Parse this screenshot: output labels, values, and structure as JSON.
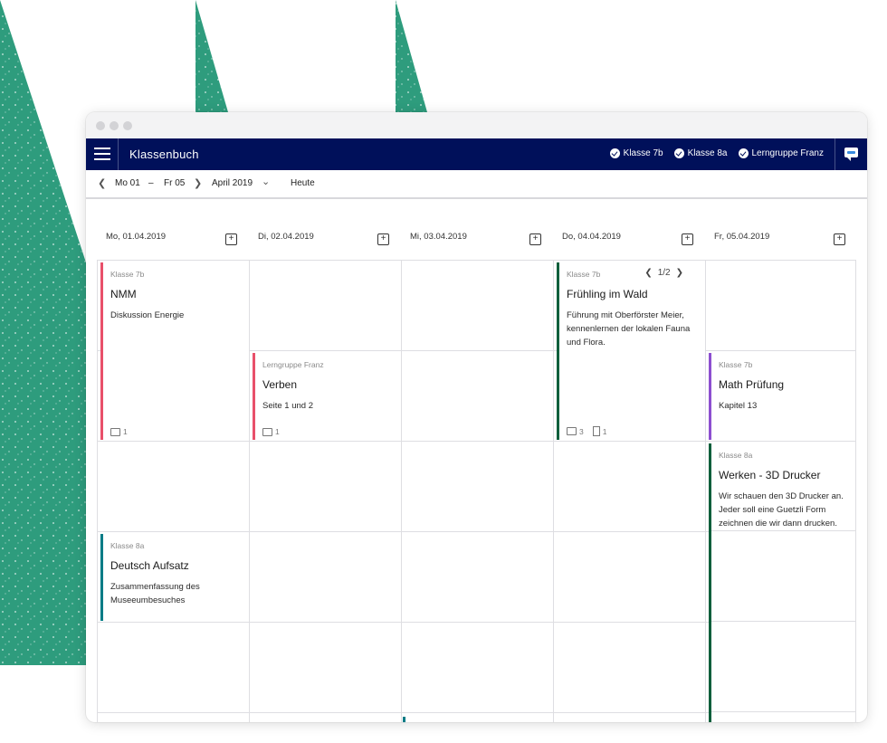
{
  "colors": {
    "brand_navy": "#00105a",
    "deco_green": "#2e9c7d",
    "event_red": "#e8506a",
    "event_green": "#0b5f3c",
    "event_purple": "#8d4fd0",
    "event_teal": "#007c86"
  },
  "app": {
    "title": "Klassenbuch",
    "menu_icon": "hamburger-icon",
    "chat_icon": "chat-bubble-icon",
    "classes": [
      "Klasse 7b",
      "Klasse 8a",
      "Lerngruppe Franz"
    ]
  },
  "nav": {
    "range_start": "Mo 01",
    "range_sep": "–",
    "range_end": "Fr 05",
    "month": "April 2019",
    "today": "Heute",
    "prev_icon": "chevron-left-icon",
    "next_icon": "chevron-right-icon",
    "month_icon": "chevron-down-icon"
  },
  "days": [
    {
      "label": "Mo, 01.04.2019"
    },
    {
      "label": "Di, 02.04.2019"
    },
    {
      "label": "Mi, 03.04.2019"
    },
    {
      "label": "Do, 04.04.2019"
    },
    {
      "label": "Fr, 05.04.2019"
    }
  ],
  "events": [
    {
      "day": 0,
      "class": "Klasse 7b",
      "title": "NMM",
      "desc": "Diskussion Energie",
      "color": "#e8506a",
      "comments": "1"
    },
    {
      "day": 1,
      "class": "Lerngruppe Franz",
      "title": "Verben",
      "desc": "Seite 1 und 2",
      "color": "#e8506a",
      "comments": "1"
    },
    {
      "day": 3,
      "class": "Klasse 7b",
      "title": "Frühling im Wald",
      "desc": "Führung mit Oberförster Meier, kennenlernen der lokalen Fauna und Flora.",
      "color": "#0b5f3c",
      "comments": "3",
      "files": "1",
      "pager": "1/2"
    },
    {
      "day": 4,
      "class": "Klasse 7b",
      "title": "Math Prüfung",
      "desc": "Kapitel 13",
      "color": "#8d4fd0"
    },
    {
      "day": 4,
      "class": "Klasse 8a",
      "title": "Werken - 3D Drucker",
      "desc": "Wir schauen den 3D Drucker an. Jeder soll eine Guetzli Form zeichnen die wir dann drucken.",
      "color": "#0b5f3c"
    },
    {
      "day": 0,
      "class": "Klasse 8a",
      "title": "Deutsch Aufsatz",
      "desc": "Zusammenfassung des Museeumbesuches",
      "color": "#007c86"
    }
  ]
}
